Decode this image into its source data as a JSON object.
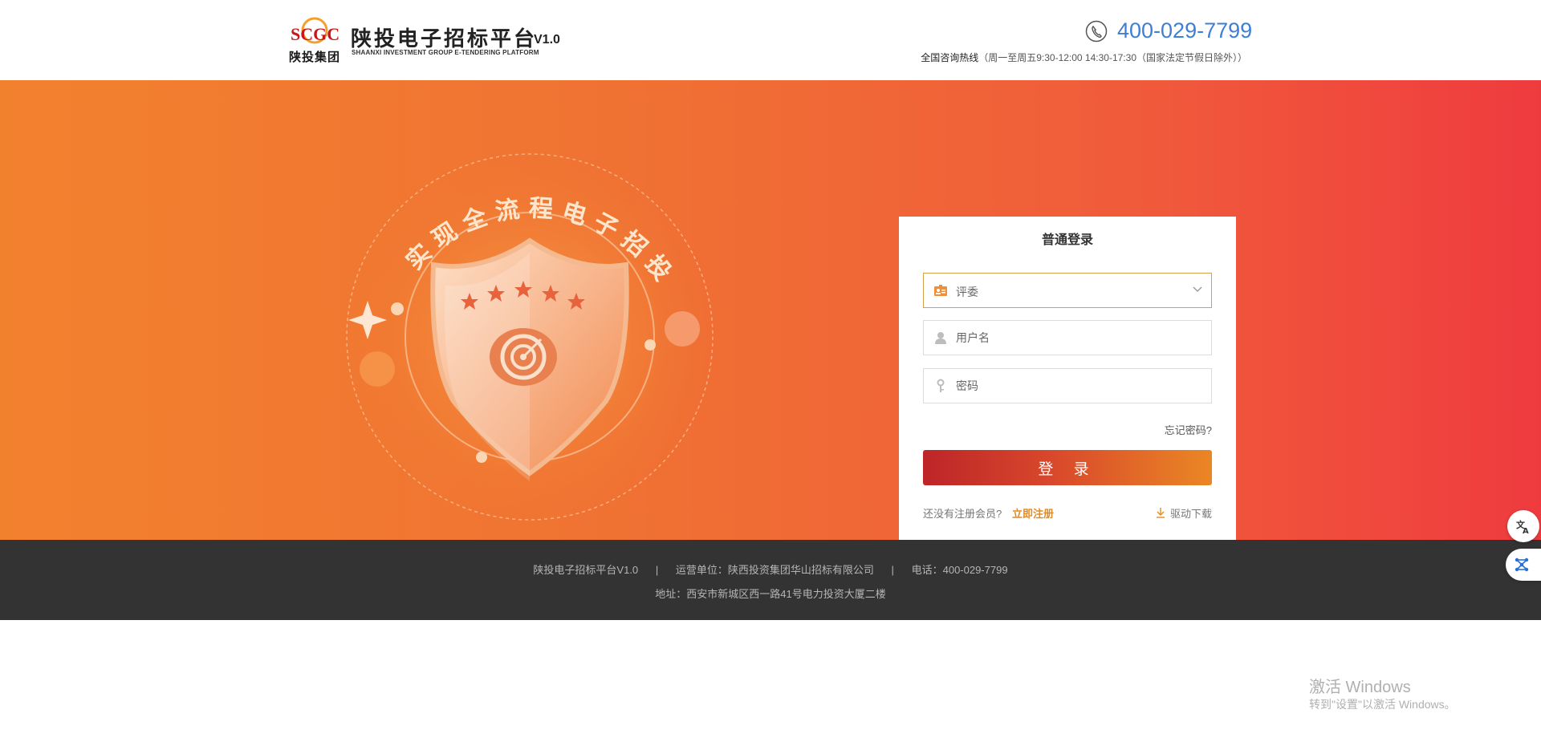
{
  "header": {
    "logo_text": "SCGC",
    "logo_cn": "陕投集团",
    "title_cn": "陕投电子招标平台",
    "version": "V1.0",
    "title_en": "SHAANXI INVESTMENT GROUP E-TENDERING PLATFORM",
    "phone": "400-029-7799",
    "hotline_label": "全国咨询热线",
    "hotline_hours": "（周一至周五9:30-12:00 14:30-17:30（国家法定节假日除外））"
  },
  "banner": {
    "slogan": "实现全流程电子招投标",
    "colors": {
      "start": "#f2812e",
      "end": "#ef3b3f"
    }
  },
  "login": {
    "title": "普通登录",
    "role_value": "评委",
    "username_placeholder": "用户名",
    "password_placeholder": "密码",
    "forgot": "忘记密码?",
    "submit": "登 录",
    "no_account": "还没有注册会员?",
    "register": "立即注册",
    "driver_download": "驱动下载"
  },
  "footer": {
    "line1": "陕投电子招标平台V1.0      |      运营单位：陕西投资集团华山招标有限公司      |      电话：400-029-7799",
    "line2": "地址：西安市新城区西一路41号电力投资大厦二楼"
  },
  "watermark": {
    "title": "激活 Windows",
    "subtitle": "转到\"设置\"以激活 Windows。"
  },
  "icons": [
    "phone-icon",
    "role-icon",
    "user-icon",
    "key-icon",
    "chevron-down-icon",
    "download-icon",
    "translate-icon",
    "network-icon"
  ]
}
